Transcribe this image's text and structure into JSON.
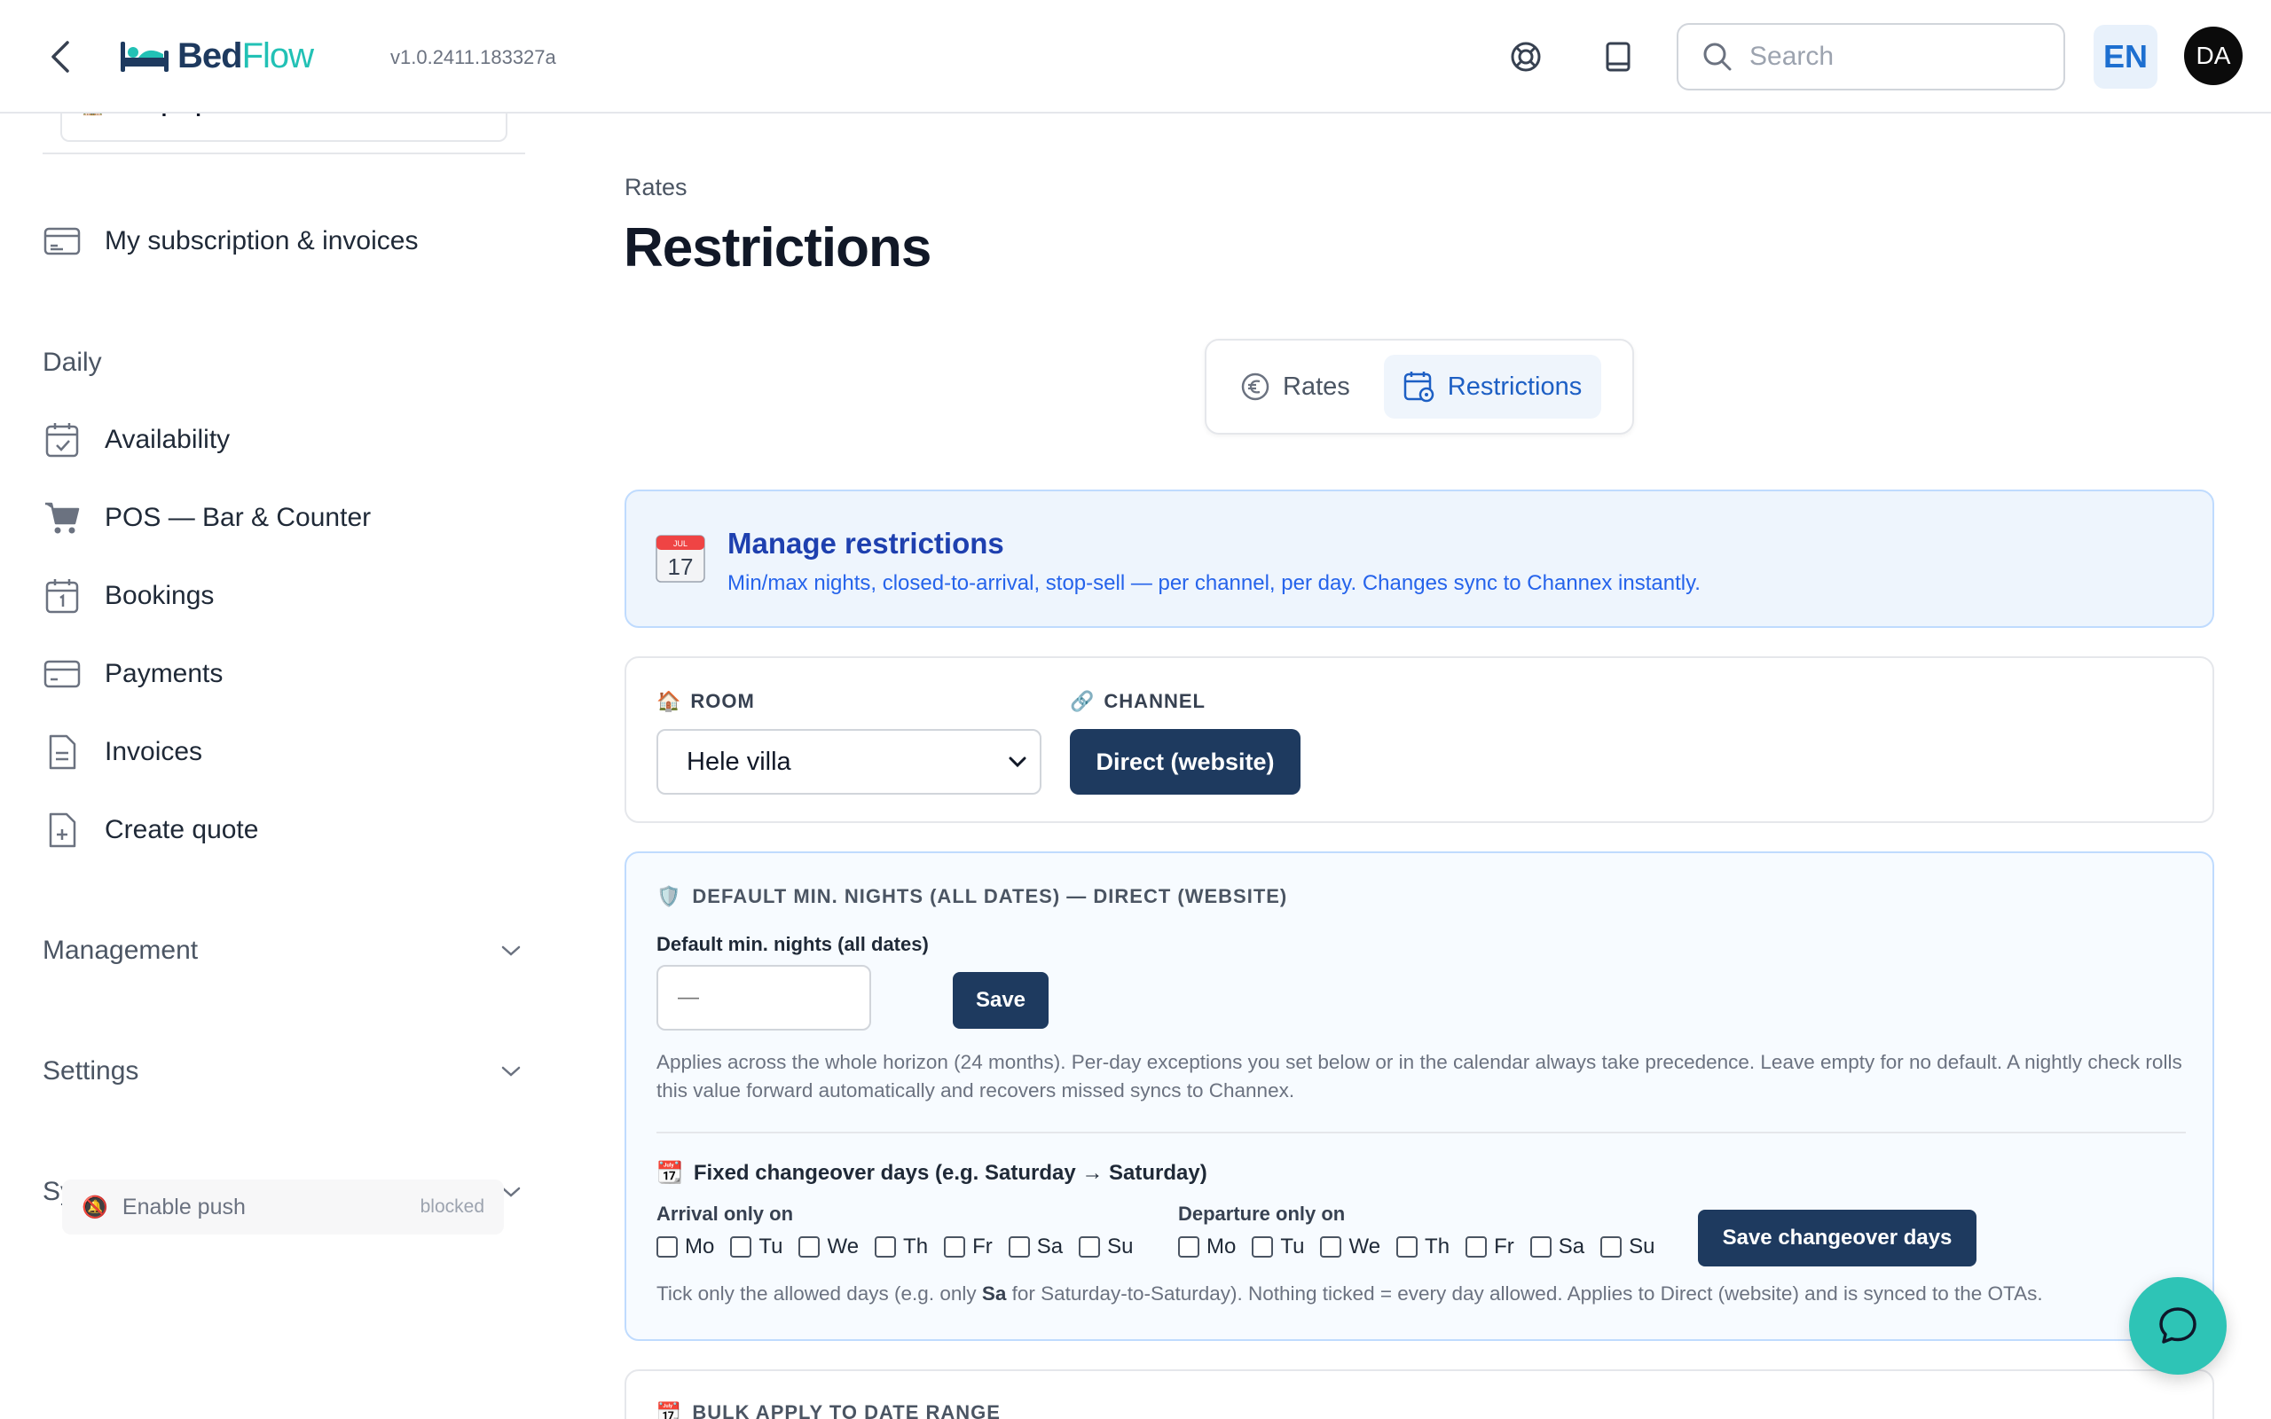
{
  "app": {
    "logo_part1": "Bed",
    "logo_part2": "Flow",
    "version": "v1.0.2411.183327a"
  },
  "header": {
    "search_placeholder": "Search",
    "language": "EN",
    "avatar_initials": "DA",
    "icons": [
      "back-chevron-icon",
      "lifebuoy-icon",
      "book-icon",
      "search-icon"
    ]
  },
  "sidebar": {
    "property_select": "Alle properties",
    "subscription_label": "My subscription & invoices",
    "section_daily": "Daily",
    "items": [
      {
        "label": "Availability",
        "icon": "calendar-check-icon"
      },
      {
        "label": "POS — Bar & Counter",
        "icon": "cart-icon"
      },
      {
        "label": "Bookings",
        "icon": "calendar-one-icon"
      },
      {
        "label": "Payments",
        "icon": "card-icon"
      },
      {
        "label": "Invoices",
        "icon": "document-icon"
      },
      {
        "label": "Create quote",
        "icon": "document-plus-icon"
      }
    ],
    "groups": [
      "Management",
      "Settings",
      "System"
    ],
    "push": {
      "label": "Enable push",
      "status": "blocked"
    }
  },
  "main": {
    "breadcrumb": "Rates",
    "title": "Restrictions",
    "tabs": [
      {
        "label": "Rates",
        "icon": "euro-icon",
        "active": false
      },
      {
        "label": "Restrictions",
        "icon": "calendar-gear-icon",
        "active": true
      }
    ],
    "info": {
      "title": "Manage restrictions",
      "subtitle": "Min/max nights, closed-to-arrival, stop-sell — per channel, per day. Changes sync to Channex instantly.",
      "calendar_day": "17",
      "calendar_month": "JUL"
    },
    "filters": {
      "room_label": "ROOM",
      "room_value": "Hele villa",
      "channel_label": "CHANNEL",
      "channel_value": "Direct (website)"
    },
    "default_min": {
      "heading": "DEFAULT MIN. NIGHTS (ALL DATES) — DIRECT (WEBSITE)",
      "field_label": "Default min. nights (all dates)",
      "placeholder": "—",
      "save_label": "Save",
      "help": "Applies across the whole horizon (24 months). Per-day exceptions you set below or in the calendar always take precedence. Leave empty for no default. A nightly check rolls this value forward automatically and recovers missed syncs to Channex.",
      "fixed_title": "Fixed changeover days (e.g. Saturday → Saturday)",
      "arrival_label": "Arrival only on",
      "departure_label": "Departure only on",
      "days": [
        "Mo",
        "Tu",
        "We",
        "Th",
        "Fr",
        "Sa",
        "Su"
      ],
      "save_changeover_label": "Save changeover days",
      "tick_help_1": "Tick only the allowed days (e.g. only ",
      "tick_help_bold": "Sa",
      "tick_help_2": " for Saturday-to-Saturday). Nothing ticked = every day allowed. Applies to Direct (website) and is synced to the OTAs."
    },
    "bulk": {
      "heading": "BULK APPLY TO DATE RANGE"
    }
  },
  "colors": {
    "navy": "#1e3a5f",
    "teal": "#2ec4b6",
    "accent_blue": "#1d5fc4",
    "info_bg": "#eef5fd"
  }
}
